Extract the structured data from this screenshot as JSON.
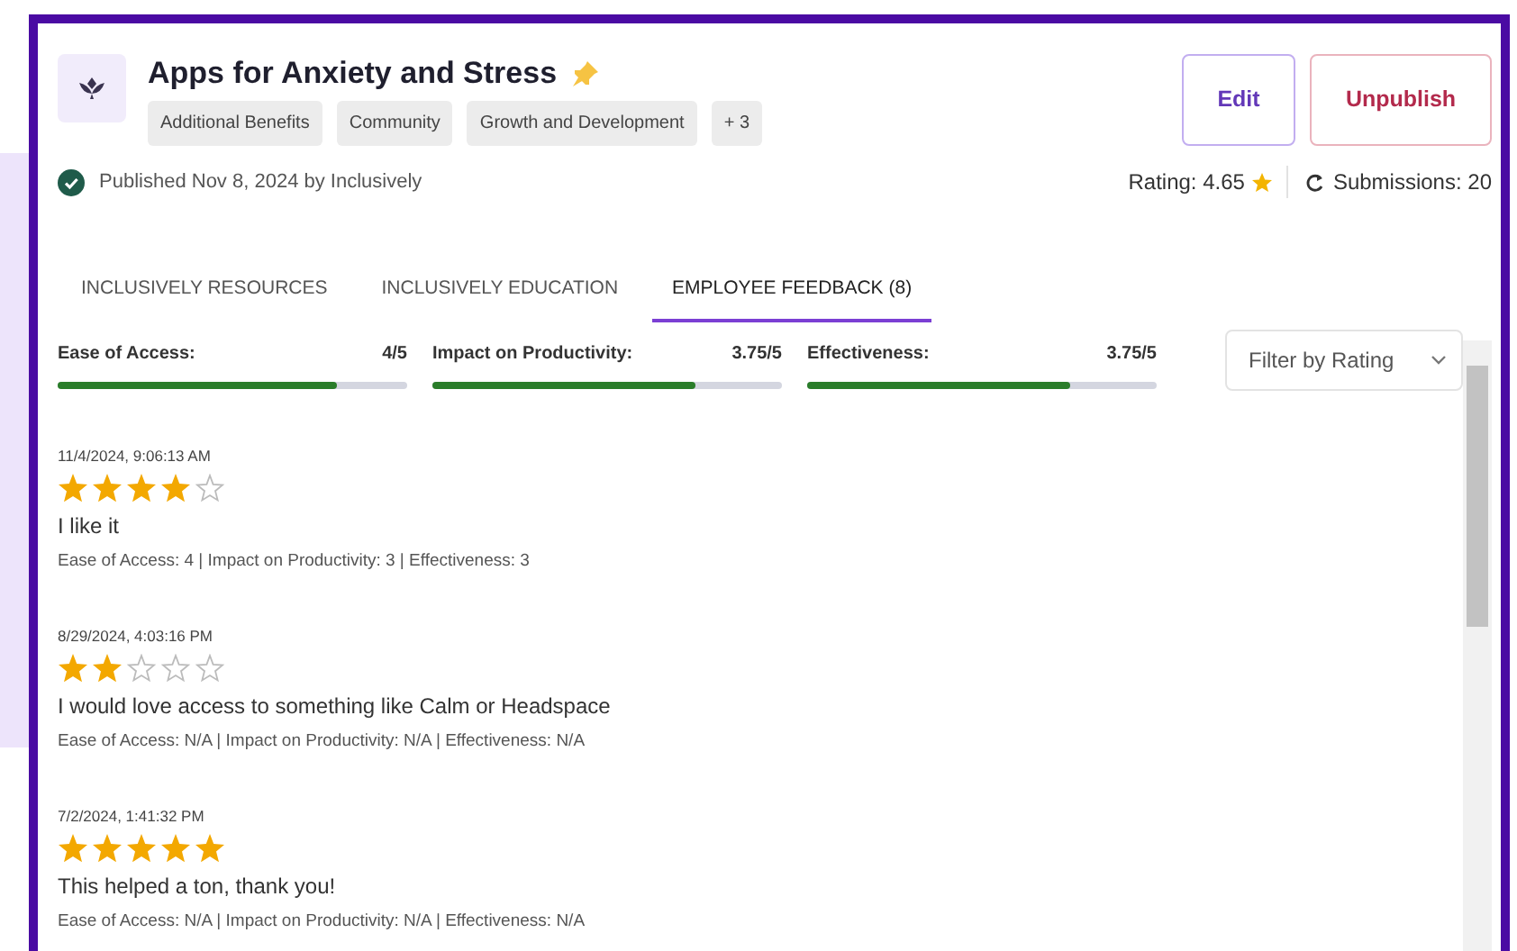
{
  "header": {
    "title": "Apps for Anxiety and Stress",
    "pinned": true,
    "tags": [
      "Additional Benefits",
      "Community",
      "Growth and Development",
      "+ 3"
    ],
    "published": "Published Nov 8, 2024 by Inclusively",
    "buttons": [
      {
        "label": "Edit",
        "kind": "edit"
      },
      {
        "label": "Unpublish",
        "kind": "unpublish"
      }
    ],
    "rating": "Rating: 4.65",
    "submissions": "Submissions: 20"
  },
  "tabs": [
    {
      "label": "INCLUSIVELY RESOURCES",
      "selected": false
    },
    {
      "label": "INCLUSIVELY EDUCATION",
      "selected": false
    },
    {
      "label": "EMPLOYEE FEEDBACK (8)",
      "selected": true
    }
  ],
  "metrics": [
    {
      "name": "Ease of Access:",
      "reading": "4/5",
      "level": 0.8
    },
    {
      "name": "Impact on Productivity:",
      "reading": "3.75/5",
      "level": 0.75
    },
    {
      "name": "Effectiveness:",
      "reading": "3.75/5",
      "level": 0.75
    }
  ],
  "filter": {
    "label": "Filter by Rating"
  },
  "reviews": [
    {
      "date": "11/4/2024, 9:06:13 AM",
      "stars": 4,
      "text": "I like it",
      "breakdown": "Ease of Access: 4 |  Impact on Productivity: 3 |  Effectiveness: 3"
    },
    {
      "date": "8/29/2024, 4:03:16 PM",
      "stars": 2,
      "text": "I would love access to something like Calm or Headspace",
      "breakdown": "Ease of Access: N/A |  Impact on Productivity: N/A |  Effectiveness: N/A"
    },
    {
      "date": "7/2/2024, 1:41:32 PM",
      "stars": 5,
      "text": "This helped a ton, thank you!",
      "breakdown": "Ease of Access: N/A |  Impact on Productivity: N/A |  Effectiveness: N/A"
    }
  ]
}
